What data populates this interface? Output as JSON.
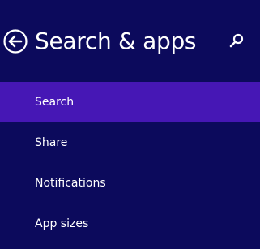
{
  "header": {
    "title": "Search & apps",
    "back_icon": "back-arrow-icon",
    "search_icon": "search-icon"
  },
  "nav": {
    "items": [
      {
        "label": "Search",
        "selected": true
      },
      {
        "label": "Share",
        "selected": false
      },
      {
        "label": "Notifications",
        "selected": false
      },
      {
        "label": "App sizes",
        "selected": false
      }
    ]
  },
  "colors": {
    "background": "#0c0a5c",
    "selected_item": "#4617b5",
    "text": "#ffffff"
  }
}
